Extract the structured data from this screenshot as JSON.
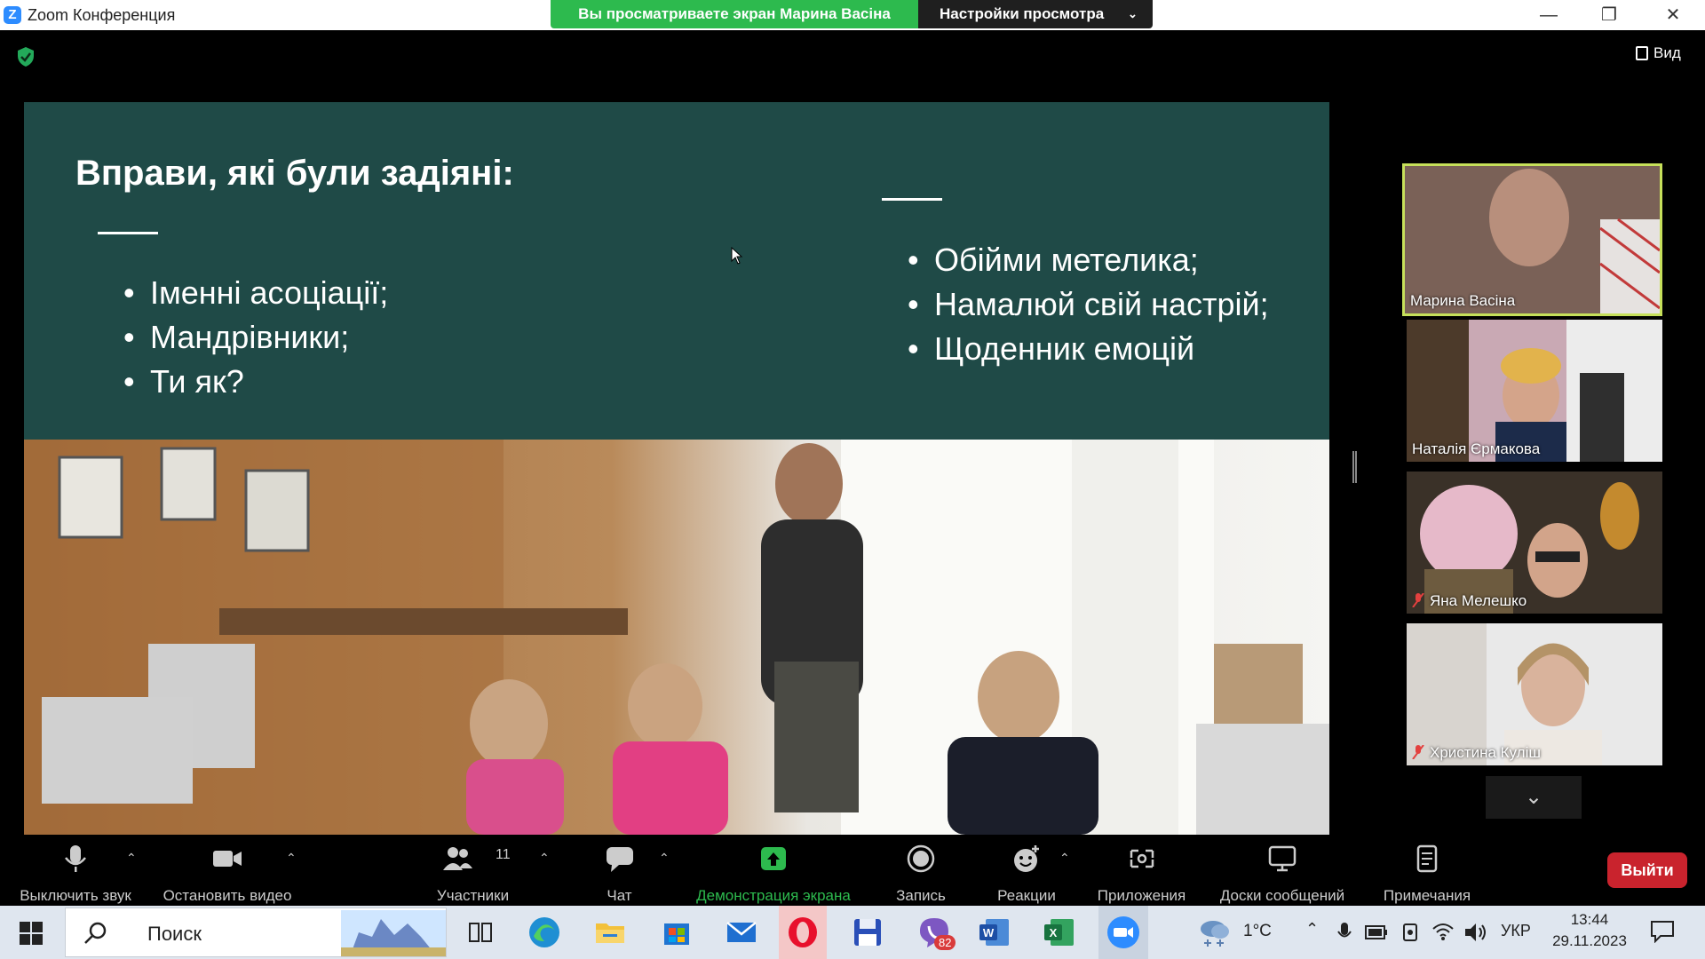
{
  "window": {
    "title": "Zoom Конференция",
    "share_banner": "Вы просматриваете экран Марина Васіна",
    "view_options_label": "Настройки просмотра"
  },
  "meeting": {
    "view_label": "Вид"
  },
  "slide": {
    "title": "Вправи, які були задіяні:",
    "left_items": [
      "Іменні асоціації;",
      "Мандрівники;",
      "Ти як?"
    ],
    "right_items": [
      "Обійми метелика;",
      "Намалюй свій настрій;",
      "Щоденник емоцій"
    ]
  },
  "participants": [
    {
      "name": "Марина Васіна",
      "muted": false,
      "active": true
    },
    {
      "name": "Наталія  Єрмакова",
      "muted": false,
      "active": false
    },
    {
      "name": "Яна Мелешко",
      "muted": true,
      "active": false
    },
    {
      "name": "Христина Куліш",
      "muted": true,
      "active": false
    }
  ],
  "toolbar": {
    "mute_label": "Выключить звук",
    "video_label": "Остановить видео",
    "participants_label": "Участники",
    "participants_count": "11",
    "chat_label": "Чат",
    "share_label": "Демонстрация экрана",
    "record_label": "Запись",
    "reactions_label": "Реакции",
    "apps_label": "Приложения",
    "whiteboards_label": "Доски сообщений",
    "notes_label": "Примечания",
    "leave_label": "Выйти"
  },
  "taskbar": {
    "search_label": "Поиск",
    "weather": "1°C",
    "language": "УКР",
    "time": "13:44",
    "date": "29.11.2023",
    "viber_badge": "82"
  },
  "colors": {
    "share_banner": "#2dba4e",
    "slide_bg": "#1f4a47",
    "active_speaker_border": "#c6e05a",
    "share_accent": "#2dba4e",
    "leave_button": "#c9232d"
  }
}
